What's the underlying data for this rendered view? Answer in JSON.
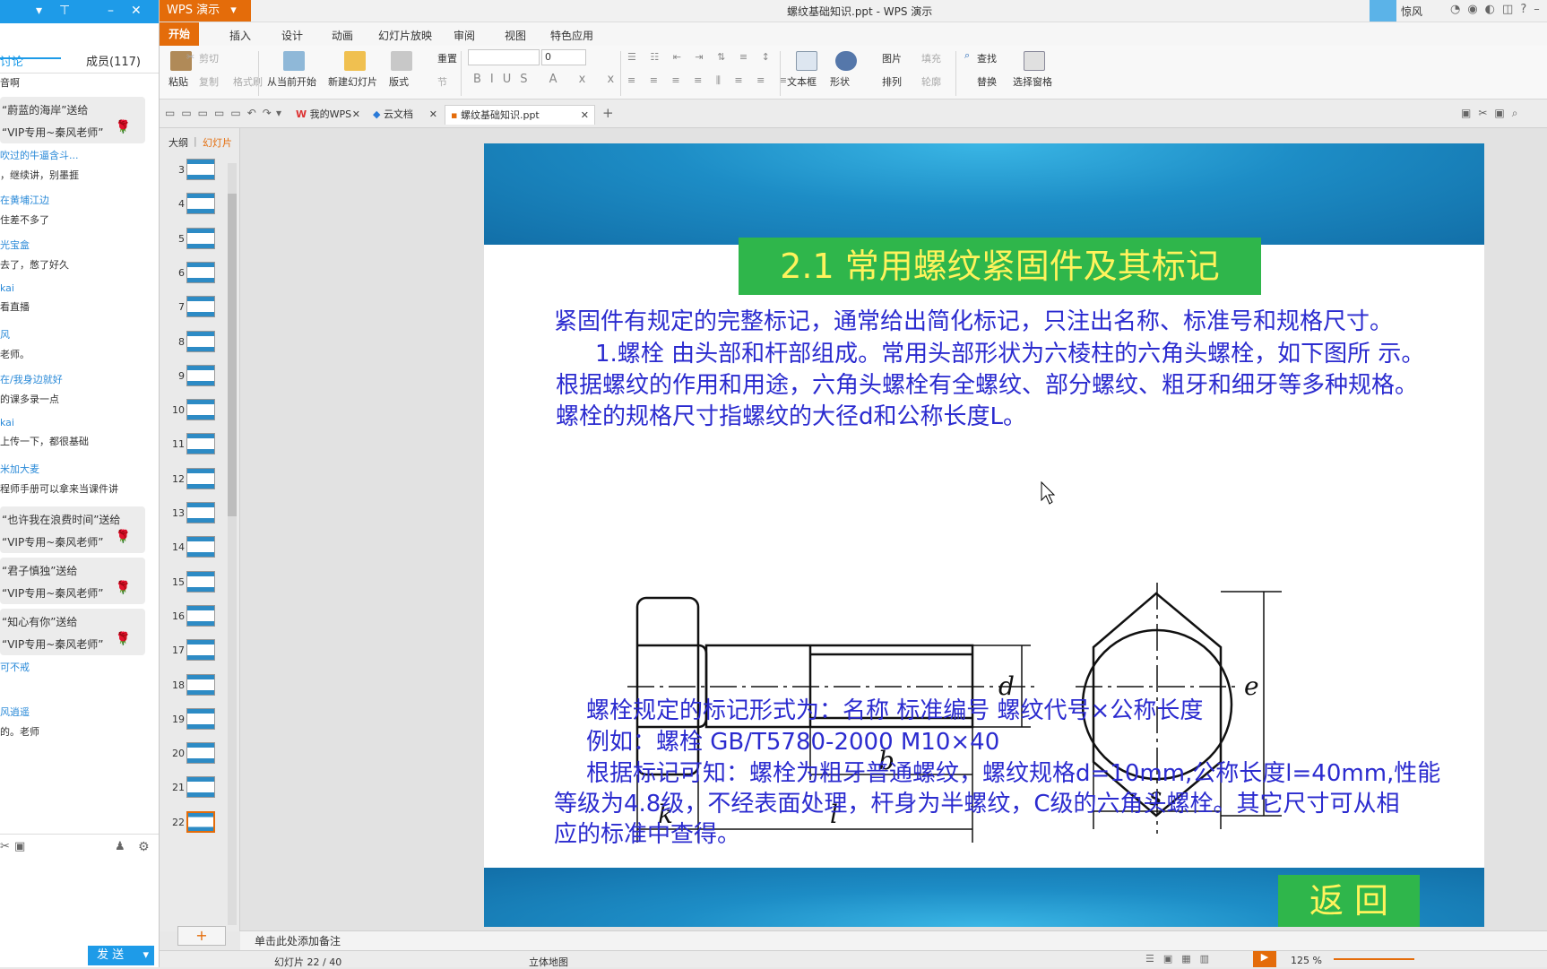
{
  "chat": {
    "tabs": [
      "讨论",
      "成员(117)"
    ],
    "first_line": "音啊",
    "messages": [
      {
        "type": "gift",
        "line1": "“蔚蓝的海岸”送给",
        "line2": "“VIP专用~秦风老师”"
      },
      {
        "type": "msg",
        "name": "吹过的牛逼含斗...",
        "text": "，继续讲，别墨捱"
      },
      {
        "type": "msg",
        "name": "在黄埔江边",
        "text": "住差不多了"
      },
      {
        "type": "msg",
        "name": "光宝盒",
        "text": "去了，憋了好久"
      },
      {
        "type": "msg",
        "name": "kai",
        "text": "看直播"
      },
      {
        "type": "msg",
        "name": "风",
        "text": "老师。"
      },
      {
        "type": "msg",
        "name": "在/我身边就好",
        "text": "的课多录一点"
      },
      {
        "type": "msg",
        "name": "kai",
        "text": "上传一下，都很基础"
      },
      {
        "type": "msg",
        "name": "米加大麦",
        "text": "程师手册可以拿来当课件讲"
      },
      {
        "type": "gift",
        "line1": "“也许我在浪费时间”送给",
        "line2": "“VIP专用~秦风老师”"
      },
      {
        "type": "gift",
        "line1": "“君子慎独”送给",
        "line2": "“VIP专用~秦风老师”"
      },
      {
        "type": "gift",
        "line1": "“知心有你”送给",
        "line2": "“VIP专用~秦风老师”"
      },
      {
        "type": "msg",
        "name": "可不戒",
        "text": ""
      },
      {
        "type": "msg",
        "name": "风逍遥",
        "text": "的。老师"
      }
    ],
    "send_label": "发 送",
    "rose_glyph": "🌹"
  },
  "window": {
    "app_menu": "WPS 演示",
    "title": "螺纹基础知识.ppt - WPS 演示",
    "user": "惊风"
  },
  "ribbon": {
    "tabs": [
      "开始",
      "插入",
      "设计",
      "动画",
      "幻灯片放映",
      "审阅",
      "视图",
      "特色应用"
    ],
    "paste": "粘贴",
    "cut": "剪切",
    "copy": "复制",
    "format_painter": "格式刷",
    "from_current": "从当前开始",
    "new_slide": "新建幻灯片",
    "layout": "版式",
    "reset": "重置",
    "section": "节",
    "font_size": "0",
    "textbox": "文本框",
    "shape": "形状",
    "picture": "图片",
    "fill": "填充",
    "arrange": "排列",
    "outline": "轮廓",
    "find": "查找",
    "replace": "替换",
    "selection_pane": "选择窗格"
  },
  "doc_tabs": [
    {
      "label": "我的WPS",
      "active": false
    },
    {
      "label": "云文档",
      "active": false
    },
    {
      "label": "螺纹基础知识.ppt",
      "active": true
    }
  ],
  "panel_tabs": [
    "大纲",
    "幻灯片"
  ],
  "thumbnails": [
    3,
    4,
    5,
    6,
    7,
    8,
    9,
    10,
    11,
    12,
    13,
    14,
    15,
    16,
    17,
    18,
    19,
    20,
    21,
    22
  ],
  "slide": {
    "title": "2.1 常用螺纹紧固件及其标记",
    "para1": "紧固件有规定的完整标记，通常给出简化标记，只注出名称、标准号和规格尺寸。",
    "para2_l1": "1.螺栓  由头部和杆部组成。常用头部形状为六棱柱的六角头螺栓，如下图所 示。",
    "para2_l2": "根据螺纹的作用和用途，六角头螺栓有全螺纹、部分螺纹、粗牙和细牙等多种规格。",
    "para2_l3": "螺栓的规格尺寸指螺纹的大径d和公称长度L。",
    "mark1": "螺栓规定的标记形式为：名称  标准编号  螺纹代号×公称长度",
    "mark2": "例如：螺栓  GB/T5780-2000  M10×40",
    "mark3_l1": "根据标记可知：螺栓为粗牙普通螺纹，螺纹规格d=10mm,公称长度l=40mm,性能",
    "mark3_l2": "等级为4.8级，不经表面处理，杆身为半螺纹，C级的六角头螺栓。其它尺寸可从相",
    "mark3_l3": "应的标准中查得。",
    "back": "返 回",
    "dims": {
      "k": "k",
      "l": "l",
      "b": "b",
      "d": "d",
      "s": "s",
      "e": "e"
    }
  },
  "notes_placeholder": "单击此处添加备注",
  "status": {
    "slide_pos": "幻灯片 22 / 40",
    "theme": "立体地图",
    "zoom": "125 %"
  }
}
